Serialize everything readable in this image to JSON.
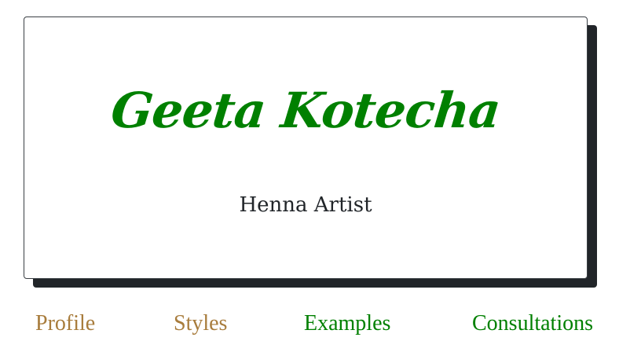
{
  "card": {
    "title": "Geeta Kotecha",
    "subtitle": "Henna Artist"
  },
  "nav": {
    "items": [
      {
        "label": "Profile",
        "color": "#a87c3c"
      },
      {
        "label": "Styles",
        "color": "#a87c3c"
      },
      {
        "label": "Examples",
        "color": "#008000"
      },
      {
        "label": "Consultations",
        "color": "#008000"
      }
    ]
  },
  "colors": {
    "title": "#008000",
    "subtitle": "#212529",
    "shadow": "#212529",
    "card_background": "#ffffff",
    "visited_link": "#a87c3c",
    "link": "#008000"
  }
}
